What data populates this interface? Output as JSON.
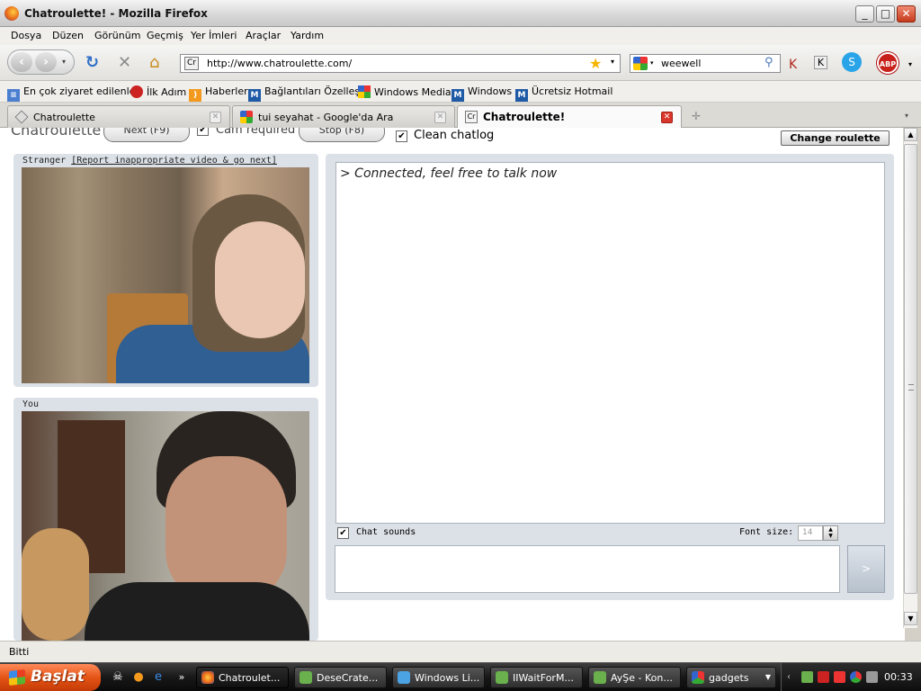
{
  "window": {
    "title": "Chatroulette! - Mozilla Firefox"
  },
  "menu": [
    "Dosya",
    "Düzen",
    "Görünüm",
    "Geçmiş",
    "Yer İmleri",
    "Araçlar",
    "Yardım"
  ],
  "nav": {
    "url": "http://www.chatroulette.com/",
    "url_favicon": "Cr",
    "search_value": "weewell"
  },
  "bookmarks": [
    "En çok ziyaret edilenler",
    "İlk Adım",
    "Haberler",
    "Bağlantıları Özelleştir",
    "Windows Media",
    "Windows",
    "Ücretsiz Hotmail"
  ],
  "tabs": [
    {
      "label": "Chatroulette"
    },
    {
      "label": "tui seyahat - Google'da Ara"
    },
    {
      "label": "Chatroulette!"
    }
  ],
  "page": {
    "brand": "Chatroulette",
    "next_label": "Next (F9)",
    "cam_required_label": "Cam required",
    "stop_label": "Stop (F8)",
    "clean_chatlog_label": "Clean chatlog",
    "change_roulette_label": "Change roulette",
    "stranger_label": "Stranger",
    "report_link": "[Report inappropriate video & go next]",
    "you_label": "You",
    "chat_message": "> Connected, feel free to talk now",
    "chat_sounds_label": "Chat sounds",
    "font_size_label": "Font size:",
    "font_size_value": "14",
    "send_label": ">"
  },
  "status": {
    "text": "Bitti"
  },
  "taskbar": {
    "start_label": "Başlat",
    "tasks": [
      {
        "label": "Chatroulet..."
      },
      {
        "label": "DeseCrate..."
      },
      {
        "label": "Windows Li..."
      },
      {
        "label": "IIWaitForM..."
      },
      {
        "label": "AyŞe - Kon..."
      },
      {
        "label": "gadgets"
      }
    ],
    "clock": "00:33"
  }
}
